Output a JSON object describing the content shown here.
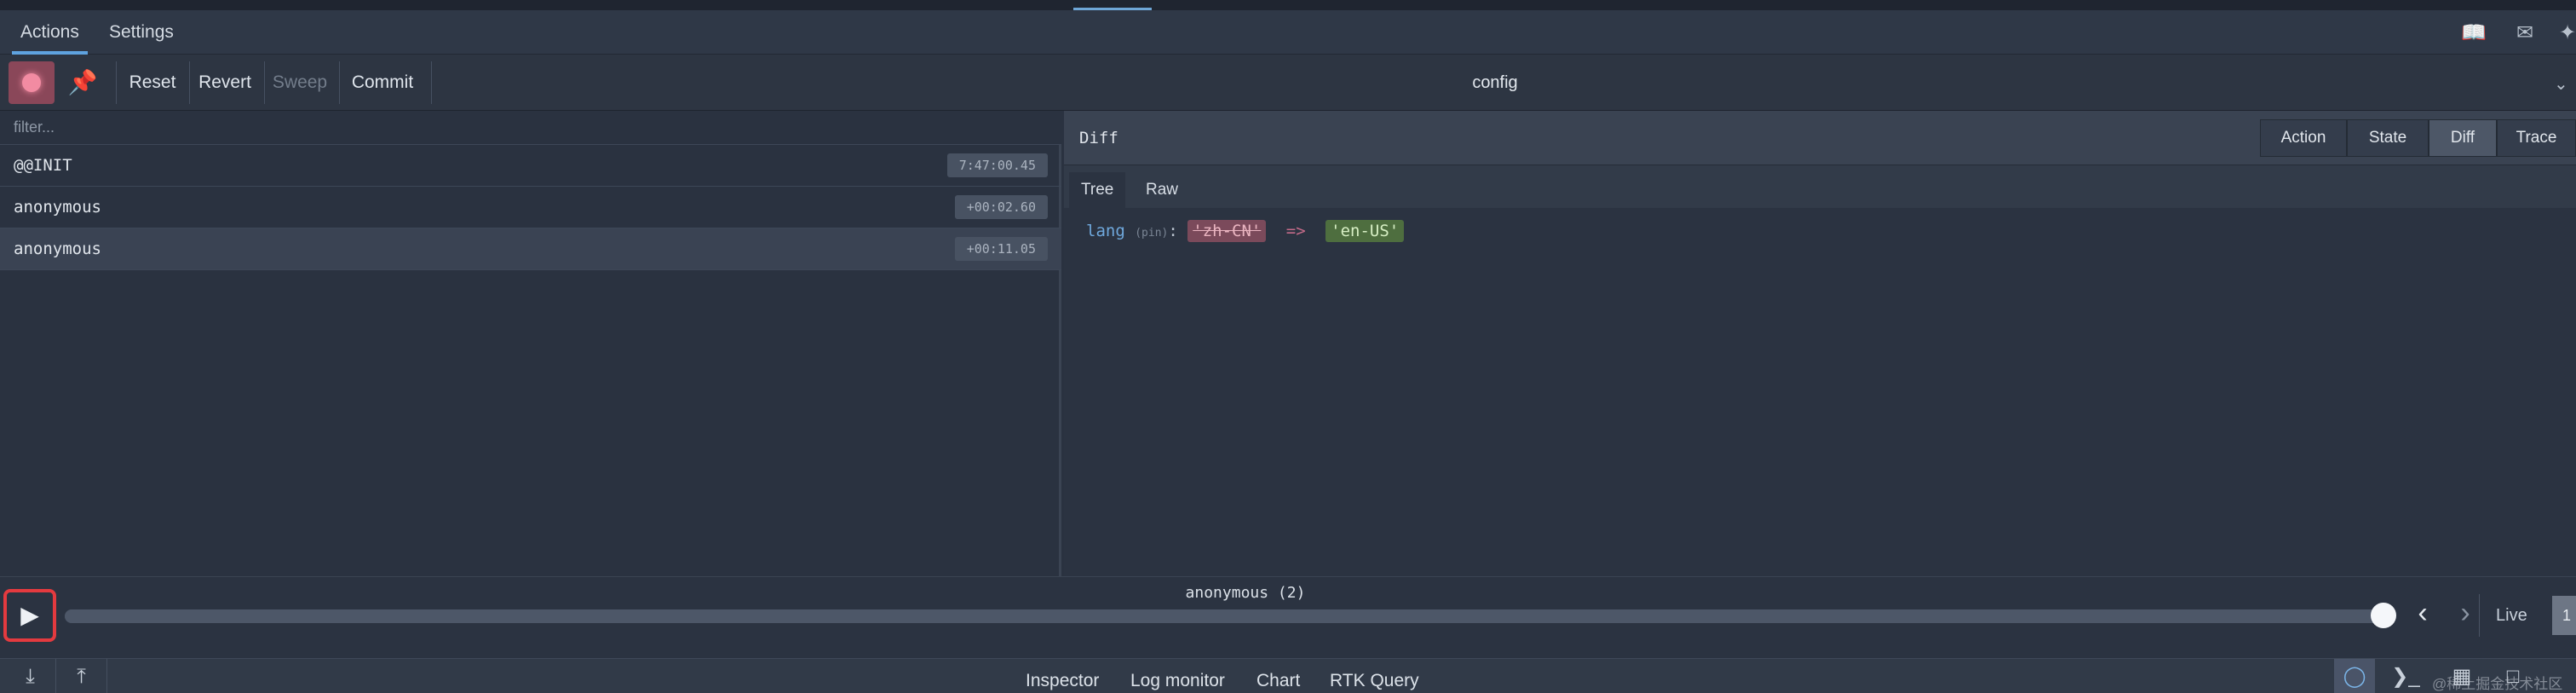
{
  "tabs": [
    {
      "label": "Actions",
      "active": true
    },
    {
      "label": "Settings",
      "active": false
    }
  ],
  "top_icons": [
    "book-open-icon",
    "comment-icon",
    "twitter-icon"
  ],
  "toolbar": {
    "record_icon": "record-icon",
    "pin_icon": "pin-icon",
    "reset_label": "Reset",
    "revert_label": "Revert",
    "sweep_label": "Sweep",
    "commit_label": "Commit",
    "instance_label": "config"
  },
  "filter": {
    "placeholder": "filter...",
    "value": ""
  },
  "actions": [
    {
      "name": "@@INIT",
      "time": "7:47:00.45",
      "selected": false
    },
    {
      "name": "anonymous",
      "time": "+00:02.60",
      "selected": false
    },
    {
      "name": "anonymous",
      "time": "+00:11.05",
      "selected": true
    }
  ],
  "inspector": {
    "title": "Diff",
    "modes": [
      "Action",
      "State",
      "Diff",
      "Trace"
    ],
    "active_mode": "Diff",
    "subtabs": [
      "Tree",
      "Raw"
    ],
    "active_subtab": "Tree",
    "diff": {
      "key": "lang",
      "key_note": "(pin)",
      "colon": ":",
      "old_value": "'zh-CN'",
      "arrow": "=>",
      "new_value": "'en-US'"
    }
  },
  "slider": {
    "current_action": "anonymous (2)",
    "play_icon": "play-icon",
    "prev_icon": "chevron-left-icon",
    "next_icon": "chevron-right-icon",
    "live_label": "Live",
    "speed_label": "1",
    "position": 1.0
  },
  "bottom": {
    "left_icons": [
      "import-icon",
      "export-icon"
    ],
    "monitors": [
      {
        "label": "Inspector",
        "active": true
      },
      {
        "label": "Log monitor",
        "active": false
      },
      {
        "label": "Chart",
        "active": false
      },
      {
        "label": "RTK Query",
        "active": false
      }
    ],
    "right_icons": [
      "dispatcher-icon",
      "terminal-icon",
      "layout-icon",
      "window-icon"
    ],
    "watermark": "@稀土掘金技术社区"
  },
  "colors": {
    "accent": "#5fa3e0",
    "record": "#f28ba2",
    "diff_removed": "#7b4a5b",
    "diff_added": "#4e6e3f",
    "highlight": "#e43a3f"
  }
}
